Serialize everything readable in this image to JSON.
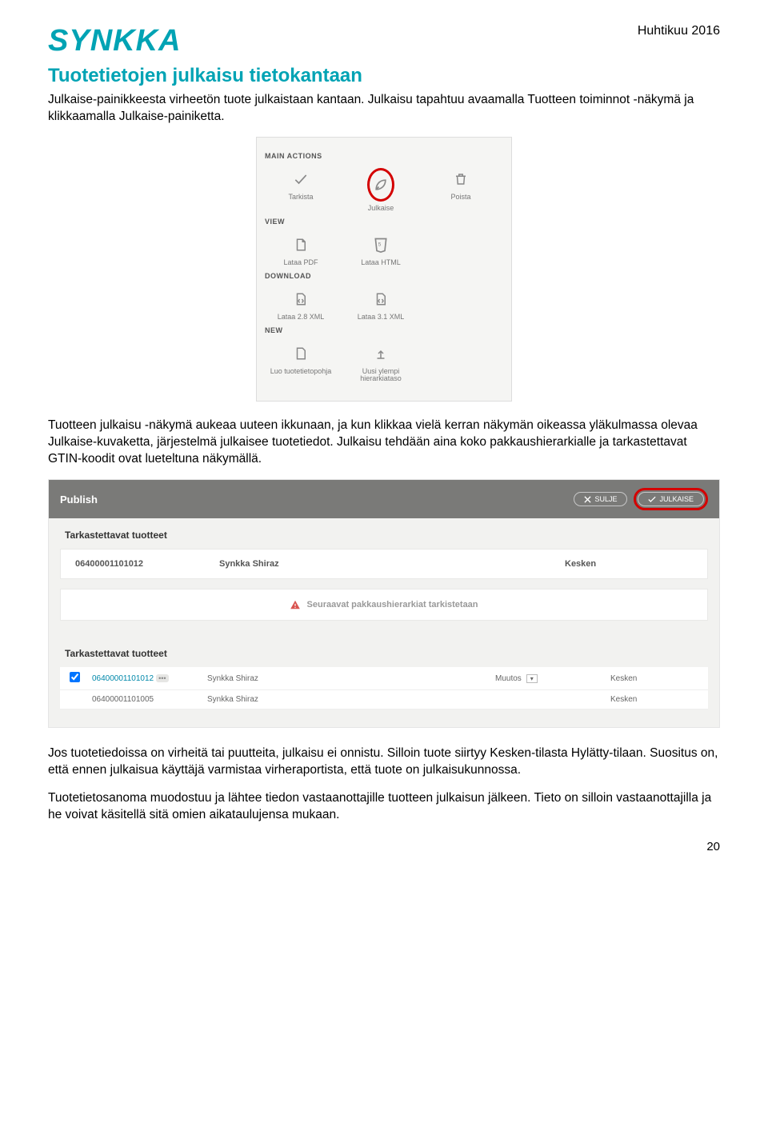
{
  "header": {
    "logo": "SYNKKA",
    "date": "Huhtikuu 2016"
  },
  "title": "Tuotetietojen julkaisu tietokantaan",
  "para1": "Julkaise-painikkeesta virheetön tuote julkaistaan kantaan. Julkaisu tapahtuu avaamalla Tuotteen toiminnot -näkymä ja klikkaamalla Julkaise-painiketta.",
  "panel": {
    "h_main": "MAIN ACTIONS",
    "main": {
      "tarkista": "Tarkista",
      "julkaise": "Julkaise",
      "poista": "Poista"
    },
    "h_view": "VIEW",
    "view": {
      "pdf": "Lataa PDF",
      "html": "Lataa HTML"
    },
    "h_download": "DOWNLOAD",
    "download": {
      "xml28": "Lataa 2.8 XML",
      "xml31": "Lataa 3.1 XML"
    },
    "h_new": "NEW",
    "newrow": {
      "luo": "Luo tuotetietopohja",
      "uusi": "Uusi ylempi hierarkiataso"
    }
  },
  "para2": "Tuotteen julkaisu -näkymä aukeaa uuteen ikkunaan, ja kun klikkaa vielä kerran näkymän oikeassa yläkulmassa olevaa Julkaise-kuvaketta, järjestelmä julkaisee tuotetiedot. Julkaisu tehdään aina koko pakkaushierarkialle ja tarkastettavat GTIN-koodit ovat lueteltuna näkymällä.",
  "publish": {
    "bar_title": "Publish",
    "btn_close": "SULJE",
    "btn_publish": "JULKAISE",
    "sec1": "Tarkastettavat tuotteet",
    "row1": {
      "gtin": "06400001101012",
      "name": "Synkka Shiraz",
      "status": "Kesken"
    },
    "warn": "Seuraavat pakkaushierarkiat tarkistetaan",
    "sec2": "Tarkastettavat tuotteet",
    "t1": {
      "gtin": "06400001101012",
      "name": "Synkka Shiraz",
      "change": "Muutos",
      "status": "Kesken"
    },
    "t2": {
      "gtin": "06400001101005",
      "name": "Synkka Shiraz",
      "change": "",
      "status": "Kesken"
    }
  },
  "para3": "Jos tuotetiedoissa on virheitä tai puutteita, julkaisu ei onnistu. Silloin tuote siirtyy Kesken-tilasta Hylätty-tilaan. Suositus on, että ennen julkaisua käyttäjä varmistaa virheraportista, että tuote on julkaisukunnossa.",
  "para4": "Tuotetietosanoma muodostuu ja lähtee tiedon vastaanottajille tuotteen julkaisun jälkeen. Tieto on silloin vastaanottajilla ja he voivat käsitellä sitä omien aikataulujensa mukaan.",
  "page_num": "20"
}
